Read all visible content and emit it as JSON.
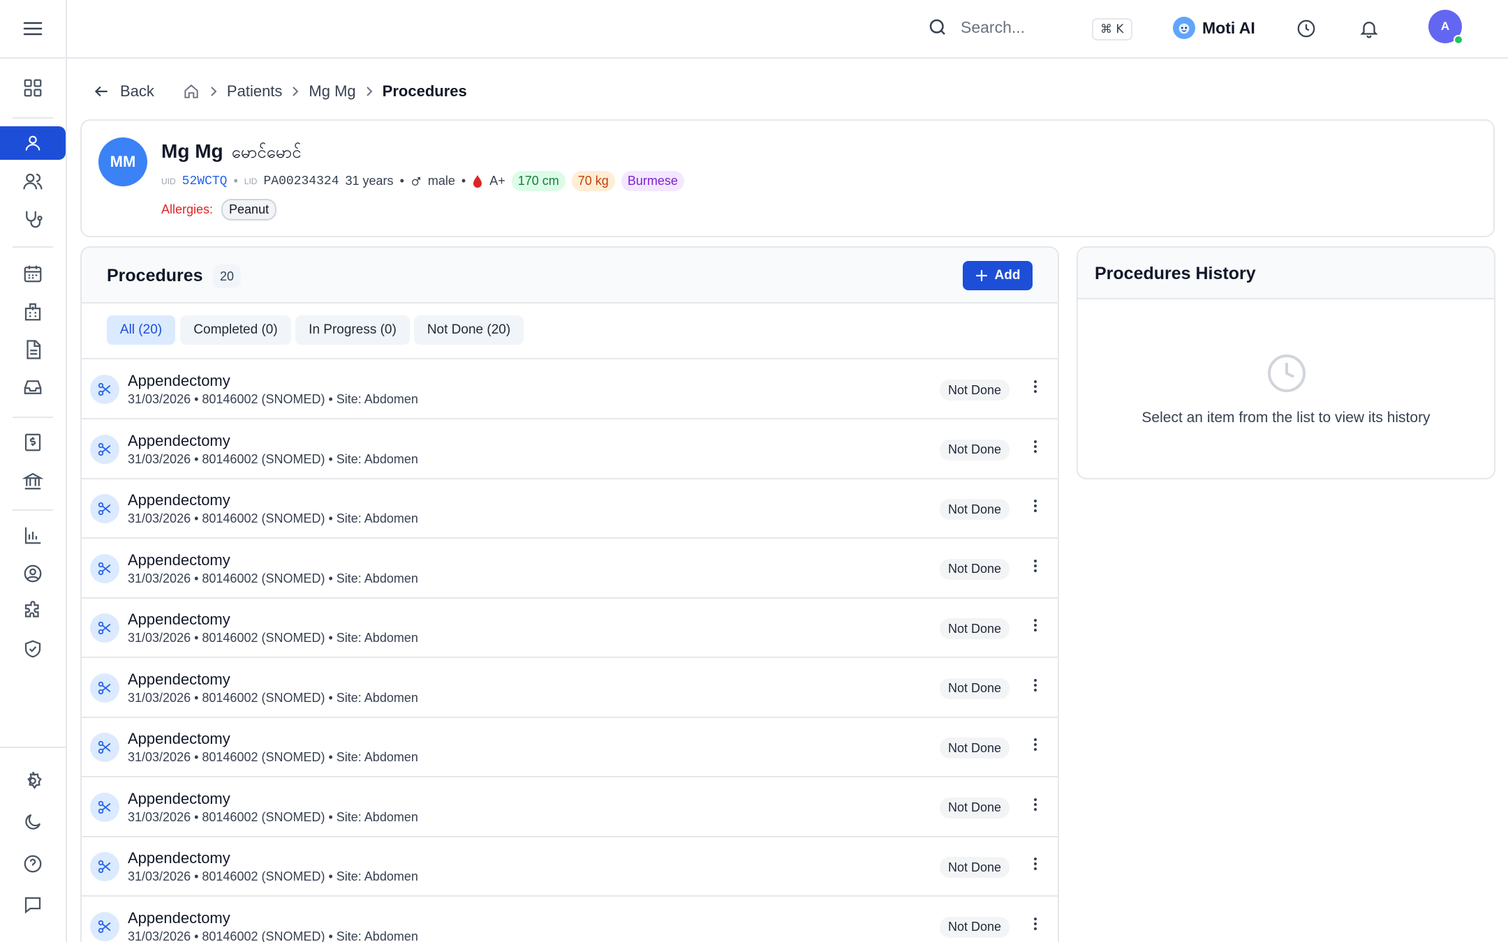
{
  "topbar": {
    "search_placeholder": "Search...",
    "shortcut": "⌘ K",
    "ai_label": "Moti AI",
    "avatar_initial": "A"
  },
  "breadcrumb": {
    "back": "Back",
    "items": [
      "Patients",
      "Mg Mg"
    ],
    "current": "Procedures"
  },
  "patient": {
    "initials": "MM",
    "name": "Mg Mg",
    "local_name": "မောင်မောင်",
    "uid_label": "UID",
    "uid": "52WCTQ",
    "lid_label": "LID",
    "lid": "PA00234324",
    "age": "31 years",
    "gender": "male",
    "blood": "A+",
    "height": "170 cm",
    "weight": "70 kg",
    "nationality": "Burmese",
    "allergies_label": "Allergies:",
    "allergies": [
      "Peanut"
    ]
  },
  "procedures": {
    "title": "Procedures",
    "count": "20",
    "add_label": "Add",
    "tabs": [
      "All (20)",
      "Completed (0)",
      "In Progress (0)",
      "Not Done (20)"
    ],
    "rows": [
      {
        "name": "Appendectomy",
        "details": "31/03/2026 • 80146002 (SNOMED) • Site: Abdomen",
        "status": "Not Done"
      },
      {
        "name": "Appendectomy",
        "details": "31/03/2026 • 80146002 (SNOMED) • Site: Abdomen",
        "status": "Not Done"
      },
      {
        "name": "Appendectomy",
        "details": "31/03/2026 • 80146002 (SNOMED) • Site: Abdomen",
        "status": "Not Done"
      },
      {
        "name": "Appendectomy",
        "details": "31/03/2026 • 80146002 (SNOMED) • Site: Abdomen",
        "status": "Not Done"
      },
      {
        "name": "Appendectomy",
        "details": "31/03/2026 • 80146002 (SNOMED) • Site: Abdomen",
        "status": "Not Done"
      },
      {
        "name": "Appendectomy",
        "details": "31/03/2026 • 80146002 (SNOMED) • Site: Abdomen",
        "status": "Not Done"
      },
      {
        "name": "Appendectomy",
        "details": "31/03/2026 • 80146002 (SNOMED) • Site: Abdomen",
        "status": "Not Done"
      },
      {
        "name": "Appendectomy",
        "details": "31/03/2026 • 80146002 (SNOMED) • Site: Abdomen",
        "status": "Not Done"
      },
      {
        "name": "Appendectomy",
        "details": "31/03/2026 • 80146002 (SNOMED) • Site: Abdomen",
        "status": "Not Done"
      },
      {
        "name": "Appendectomy",
        "details": "31/03/2026 • 80146002 (SNOMED) • Site: Abdomen",
        "status": "Not Done"
      }
    ]
  },
  "history": {
    "title": "Procedures History",
    "empty_text": "Select an item from the list to view its history"
  }
}
